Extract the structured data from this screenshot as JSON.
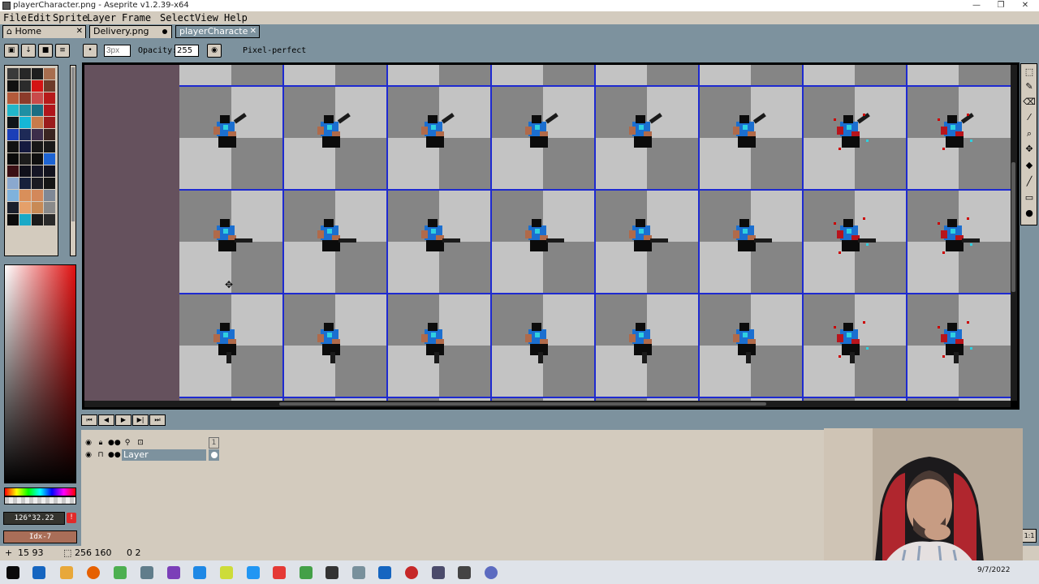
{
  "window": {
    "title": "playerCharacter.png - Aseprite v1.2.39-x64",
    "minimize": "—",
    "maximize": "❐",
    "close": "✕"
  },
  "menu": [
    "File",
    "Edit",
    "Sprite",
    "Layer",
    "Frame",
    "Select",
    "View",
    "Help"
  ],
  "tabs": [
    {
      "label": "Home",
      "icon": "home-icon",
      "close": "✕"
    },
    {
      "label": "Delivery.png",
      "modified": true
    },
    {
      "label": "playerCharacte",
      "close": "✕",
      "active": true
    }
  ],
  "toolbar": {
    "lock_icons": [
      "lock-icon",
      "arrow-down-icon",
      "stop-icon",
      "menu-icon"
    ],
    "brush_size_placeholder": "3px",
    "opacity_label": "Opacity:",
    "opacity_value": "255",
    "pixel_perfect_label": "Pixel-perfect"
  },
  "palette": {
    "colors": [
      "#3a3a3a",
      "#272727",
      "#1e1e1e",
      "#a76e4f",
      "#101010",
      "#2b2b2b",
      "#d41414",
      "#6d3b2a",
      "#b35a3a",
      "#8b3b2a",
      "#c94a4a",
      "#b71a1a",
      "#21b6c9",
      "#1f8fa3",
      "#1c6d82",
      "#b0161c",
      "#0f1418",
      "#16b7d6",
      "#c87b4b",
      "#9b1c1c",
      "#1b3fb8",
      "#1e2a57",
      "#3d2d4a",
      "#3b2521",
      "#121212",
      "#151a3f",
      "#171717",
      "#1a1a1a",
      "#0a0a0a",
      "#1c1c1c",
      "#0f0f0f",
      "#1e64d2",
      "#3b0f14",
      "#10101a",
      "#151525",
      "#13131e",
      "#8aa8cf",
      "#17213c",
      "#1a1a22",
      "#151515",
      "#7fb2dc",
      "#d98f5a",
      "#d3885a",
      "#7f8896",
      "#1a1f2b",
      "#e5a06a",
      "#c88a55",
      "#8a8a8a",
      "#0b0b0b",
      "#1aa9c7",
      "#1b1b1b",
      "#2a2a2a"
    ]
  },
  "colors": {
    "foreground_label": "126°32.22",
    "foreground_color": "#34342f",
    "background_label": "Idx-7",
    "background_color": "#a96e58",
    "warning_icon": "!"
  },
  "canvas": {
    "background": "#65515d",
    "grid_color": "#1e2ad0",
    "checker_dark": "#858585",
    "checker_light": "#c3c3c3"
  },
  "tools": [
    "marquee-icon",
    "pencil-icon",
    "eraser-icon",
    "eyedropper-icon",
    "zoom-icon",
    "move-icon",
    "fill-icon",
    "line-icon",
    "rectangle-icon",
    "blob-icon",
    "blur-icon"
  ],
  "playback": [
    "⏮",
    "◀",
    "▶",
    "▶|",
    "⏭"
  ],
  "timeline": {
    "frame_number": "1",
    "layer_name": "Layer"
  },
  "status": {
    "cursor_pos": "15  93",
    "sprite_size": "256  160",
    "frame_info": "0  2"
  },
  "taskbar": {
    "date": "9/7/2022"
  }
}
